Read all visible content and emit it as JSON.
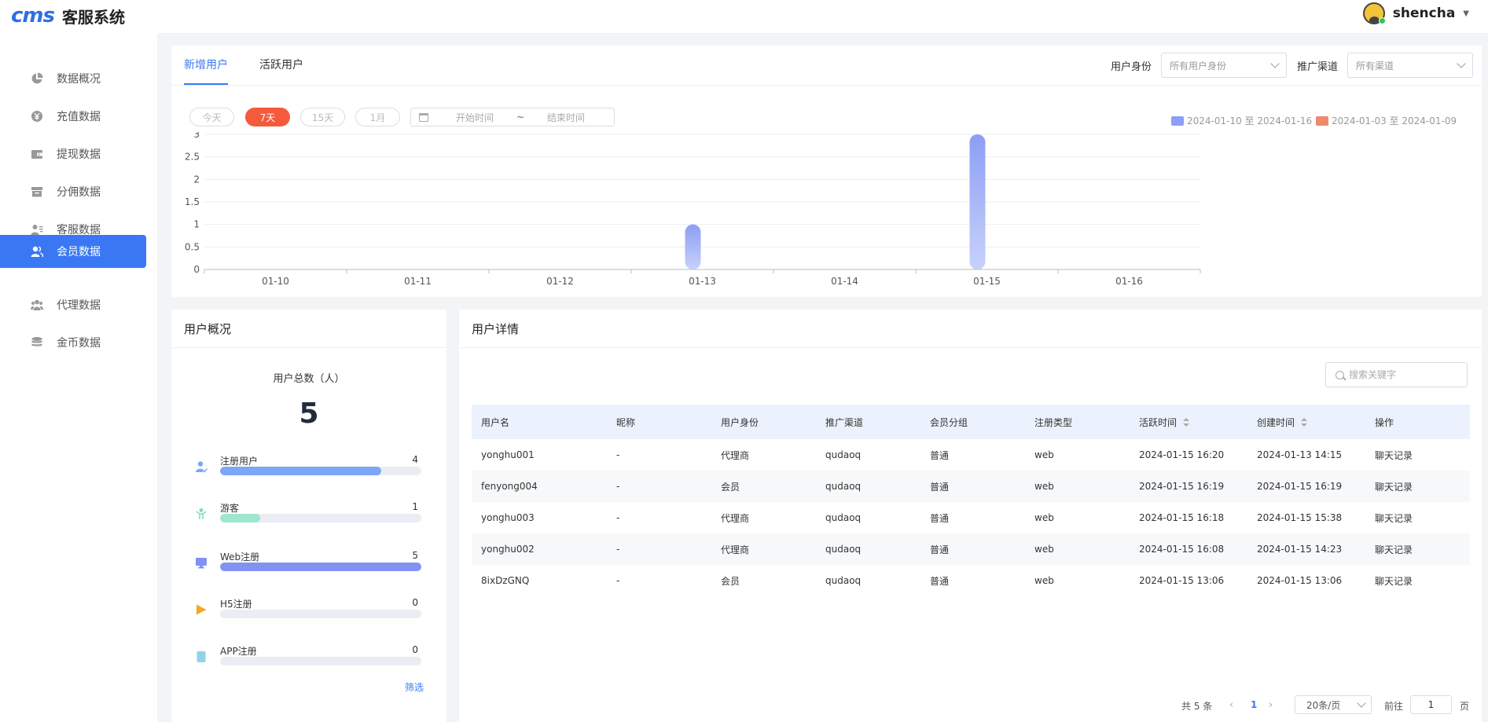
{
  "app": {
    "logo": "cms",
    "title": "客服系统",
    "user": "shencha"
  },
  "sidebar": {
    "items": [
      {
        "label": "数据概况",
        "icon": "pie-chart-icon",
        "active": false
      },
      {
        "label": "充值数据",
        "icon": "yen-coin-icon",
        "active": false
      },
      {
        "label": "提现数据",
        "icon": "wallet-icon",
        "active": false
      },
      {
        "label": "分佣数据",
        "icon": "archive-box-icon",
        "active": false
      },
      {
        "label": "客服数据",
        "icon": "user-list-icon",
        "active": false
      },
      {
        "label": "会员数据",
        "icon": "users-icon",
        "active": true
      },
      {
        "label": "代理数据",
        "icon": "team-icon",
        "active": false
      },
      {
        "label": "金币数据",
        "icon": "coin-stack-icon",
        "active": false
      }
    ]
  },
  "chart_panel": {
    "tabs": [
      "新增用户",
      "活跃用户"
    ],
    "active_tab": 0,
    "filters": {
      "identity_label": "用户身份",
      "identity_value": "所有用户身份",
      "channel_label": "推广渠道",
      "channel_value": "所有渠道"
    },
    "range_buttons": [
      "今天",
      "7天",
      "15天",
      "1月"
    ],
    "active_range": 1,
    "date_start_placeholder": "开始时间",
    "date_separator": "~",
    "date_end_placeholder": "结束时间"
  },
  "chart_data": {
    "type": "bar",
    "categories": [
      "01-10",
      "01-11",
      "01-12",
      "01-13",
      "01-14",
      "01-15",
      "01-16"
    ],
    "series": [
      {
        "name": "2024-01-10 至 2024-01-16",
        "values": [
          0,
          0,
          0,
          1,
          0,
          3,
          0
        ],
        "color": "#8c9ef5"
      },
      {
        "name": "2024-01-03 至 2024-01-09",
        "values": [
          0,
          0,
          0,
          0,
          0,
          0,
          0
        ],
        "color": "#f08a6e"
      }
    ],
    "yticks": [
      "0",
      "0.5",
      "1",
      "1.5",
      "2",
      "2.5",
      "3"
    ],
    "ylim": [
      0,
      3
    ],
    "grid": true,
    "legend": "top-right"
  },
  "overview": {
    "title": "用户概况",
    "total_label": "用户总数（人）",
    "total_value": "5",
    "stats": [
      {
        "label": "注册用户",
        "value": "4",
        "fraction": 0.8,
        "color": "#7ea6f6",
        "icon": "registered-user-icon",
        "icon_color": "#7ea6f6"
      },
      {
        "label": "游客",
        "value": "1",
        "fraction": 0.2,
        "color": "#9ee6cf",
        "icon": "guest-icon",
        "icon_color": "#7fdcc0"
      },
      {
        "label": "Web注册",
        "value": "5",
        "fraction": 1.0,
        "color": "#8193f2",
        "icon": "monitor-icon",
        "icon_color": "#8193f2"
      },
      {
        "label": "H5注册",
        "value": "0",
        "fraction": 0,
        "color": "#f5a623",
        "icon": "play-icon",
        "icon_color": "#f5a623"
      },
      {
        "label": "APP注册",
        "value": "0",
        "fraction": 0,
        "color": "#8fd3ea",
        "icon": "tablet-icon",
        "icon_color": "#8fd3ea"
      }
    ],
    "filter_link": "筛选"
  },
  "details": {
    "title": "用户详情",
    "search_placeholder": "搜索关键字",
    "columns": [
      "用户名",
      "昵称",
      "用户身份",
      "推广渠道",
      "会员分组",
      "注册类型",
      "活跃时间",
      "创建时间",
      "操作"
    ],
    "rows": [
      {
        "username": "yonghu001",
        "nickname": "-",
        "identity": "代理商",
        "channel": "qudaoq",
        "group": "普通",
        "reg_type": "web",
        "active_time": "2024-01-15 16:20",
        "created": "2024-01-13 14:15",
        "action": "聊天记录"
      },
      {
        "username": "fenyong004",
        "nickname": "-",
        "identity": "会员",
        "channel": "qudaoq",
        "group": "普通",
        "reg_type": "web",
        "active_time": "2024-01-15 16:19",
        "created": "2024-01-15 16:19",
        "action": "聊天记录"
      },
      {
        "username": "yonghu003",
        "nickname": "-",
        "identity": "代理商",
        "channel": "qudaoq",
        "group": "普通",
        "reg_type": "web",
        "active_time": "2024-01-15 16:18",
        "created": "2024-01-15 15:38",
        "action": "聊天记录"
      },
      {
        "username": "yonghu002",
        "nickname": "-",
        "identity": "代理商",
        "channel": "qudaoq",
        "group": "普通",
        "reg_type": "web",
        "active_time": "2024-01-15 16:08",
        "created": "2024-01-15 14:23",
        "action": "聊天记录"
      },
      {
        "username": "8ixDzGNQ",
        "nickname": "-",
        "identity": "会员",
        "channel": "qudaoq",
        "group": "普通",
        "reg_type": "web",
        "active_time": "2024-01-15 13:06",
        "created": "2024-01-15 13:06",
        "action": "聊天记录"
      }
    ],
    "pagination": {
      "total": "共 5 条",
      "current": "1",
      "page_size": "20条/页",
      "goto_label": "前往",
      "goto_value": "1",
      "page_suffix": "页"
    }
  }
}
